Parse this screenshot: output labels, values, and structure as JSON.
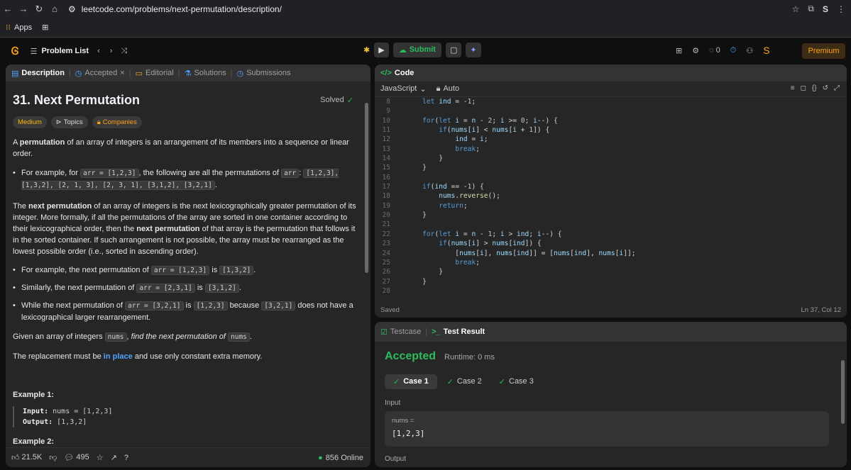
{
  "browser": {
    "url": "leetcode.com/problems/next-permutation/description/",
    "apps_label": "Apps"
  },
  "nav": {
    "problem_list": "Problem List",
    "submit": "Submit",
    "premium": "Premium",
    "streak": "0"
  },
  "left_tabs": [
    "Description",
    "Accepted",
    "Editorial",
    "Solutions",
    "Submissions"
  ],
  "problem": {
    "title": "31. Next Permutation",
    "status": "Solved",
    "difficulty": "Medium",
    "topics": "Topics",
    "companies": "Companies"
  },
  "desc": {
    "p1_a": "A ",
    "p1_b": "permutation",
    "p1_c": " of an array of integers is an arrangement of its members into a sequence or linear order.",
    "b1_a": "For example, for ",
    "b1_code1": "arr = [1,2,3]",
    "b1_b": ", the following are all the permutations of ",
    "b1_code2": "arr",
    "b1_c": ": ",
    "b1_code3": "[1,2,3], [1,3,2], [2, 1, 3], [2, 3, 1], [3,1,2], [3,2,1]",
    "b1_d": ".",
    "p2_a": "The ",
    "p2_b": "next permutation",
    "p2_c": " of an array of integers is the next lexicographically greater permutation of its integer. More formally, if all the permutations of the array are sorted in one container according to their lexicographical order, then the ",
    "p2_d": "next permutation",
    "p2_e": " of that array is the permutation that follows it in the sorted container. If such arrangement is not possible, the array must be rearranged as the lowest possible order (i.e., sorted in ascending order).",
    "b2_a": "For example, the next permutation of ",
    "b2_code1": "arr = [1,2,3]",
    "b2_b": " is ",
    "b2_code2": "[1,3,2]",
    "b2_c": ".",
    "b3_a": "Similarly, the next permutation of ",
    "b3_code1": "arr = [2,3,1]",
    "b3_b": " is ",
    "b3_code2": "[3,1,2]",
    "b3_c": ".",
    "b4_a": "While the next permutation of ",
    "b4_code1": "arr = [3,2,1]",
    "b4_b": " is ",
    "b4_code2": "[1,2,3]",
    "b4_c": " because ",
    "b4_code3": "[3,2,1]",
    "b4_d": " does not have a lexicographical larger rearrangement.",
    "p3_a": "Given an array of integers ",
    "p3_code": "nums",
    "p3_b": ", ",
    "p3_c": "find the next permutation of",
    "p3_d": " ",
    "p3_code2": "nums",
    "p3_e": ".",
    "p4_a": "The replacement must be ",
    "p4_b": "in place",
    "p4_c": " and use only constant extra memory.",
    "ex1": "Example 1:",
    "ex1_in_k": "Input:",
    "ex1_in_v": " nums = [1,2,3]",
    "ex1_out_k": "Output:",
    "ex1_out_v": " [1,3,2]",
    "ex2": "Example 2:"
  },
  "left_footer": {
    "likes": "21.5K",
    "comments": "495",
    "online": "856 Online"
  },
  "code": {
    "title": "Code",
    "lang": "JavaScript",
    "mode": "Auto",
    "saved": "Saved",
    "cursor": "Ln 37, Col 12",
    "lines": [
      {
        "n": "8",
        "t": "    let ind = -1;"
      },
      {
        "n": "9",
        "t": ""
      },
      {
        "n": "10",
        "t": "    for(let i = n - 2; i >= 0; i--) {"
      },
      {
        "n": "11",
        "t": "        if(nums[i] < nums[i + 1]) {"
      },
      {
        "n": "12",
        "t": "            ind = i;"
      },
      {
        "n": "13",
        "t": "            break;"
      },
      {
        "n": "14",
        "t": "        }"
      },
      {
        "n": "15",
        "t": "    }"
      },
      {
        "n": "16",
        "t": ""
      },
      {
        "n": "17",
        "t": "    if(ind == -1) {"
      },
      {
        "n": "18",
        "t": "        nums.reverse();"
      },
      {
        "n": "19",
        "t": "        return;"
      },
      {
        "n": "20",
        "t": "    }"
      },
      {
        "n": "21",
        "t": ""
      },
      {
        "n": "22",
        "t": "    for(let i = n - 1; i > ind; i--) {"
      },
      {
        "n": "23",
        "t": "        if(nums[i] > nums[ind]) {"
      },
      {
        "n": "24",
        "t": "            [nums[i], nums[ind]] = [nums[ind], nums[i]];"
      },
      {
        "n": "25",
        "t": "            break;"
      },
      {
        "n": "26",
        "t": "        }"
      },
      {
        "n": "27",
        "t": "    }"
      },
      {
        "n": "28",
        "t": ""
      }
    ]
  },
  "test": {
    "tab1": "Testcase",
    "tab2": "Test Result",
    "result": "Accepted",
    "runtime": "Runtime: 0 ms",
    "cases": [
      "Case 1",
      "Case 2",
      "Case 3"
    ],
    "input_label": "Input",
    "var_label": "nums =",
    "var_value": "[1,2,3]",
    "output_label": "Output"
  }
}
